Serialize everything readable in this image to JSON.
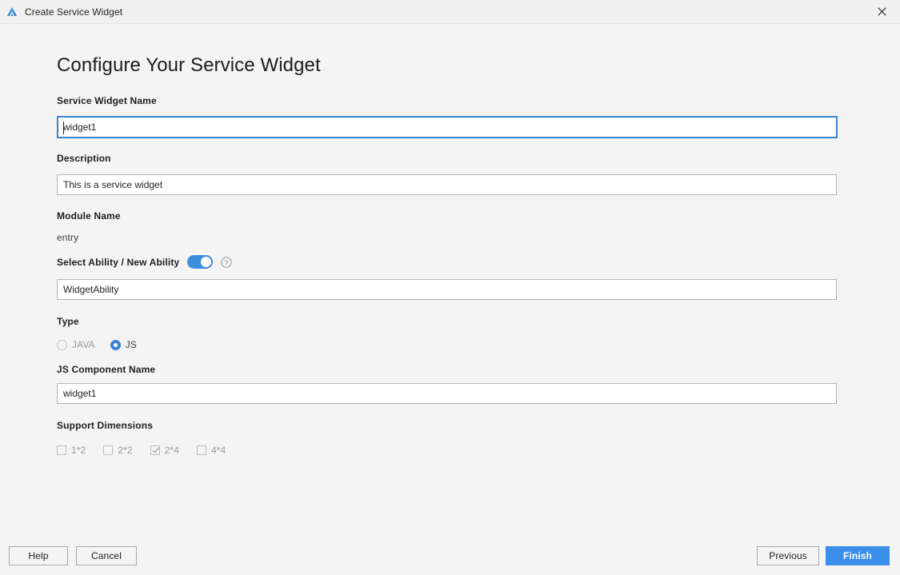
{
  "window": {
    "title": "Create Service Widget",
    "app_icon": "deveco-logo-icon",
    "close_icon": "close-icon"
  },
  "page": {
    "heading": "Configure Your Service Widget"
  },
  "form": {
    "service_widget_name": {
      "label": "Service Widget Name",
      "value": "widget1",
      "focused": true
    },
    "description": {
      "label": "Description",
      "value": "This is a service widget"
    },
    "module_name": {
      "label": "Module Name",
      "value": "entry"
    },
    "select_ability": {
      "label": "Select Ability / New Ability",
      "toggle_on": true,
      "help_icon": "question-circle-icon",
      "value": "WidgetAbility"
    },
    "type": {
      "label": "Type",
      "options": [
        {
          "label": "JAVA",
          "selected": false,
          "disabled": true
        },
        {
          "label": "JS",
          "selected": true,
          "disabled": false
        }
      ]
    },
    "js_component_name": {
      "label": "JS Component Name",
      "value": "widget1"
    },
    "support_dimensions": {
      "label": "Support Dimensions",
      "options": [
        {
          "label": "1*2",
          "checked": false,
          "disabled": true
        },
        {
          "label": "2*2",
          "checked": false,
          "disabled": true
        },
        {
          "label": "2*4",
          "checked": true,
          "disabled": true
        },
        {
          "label": "4*4",
          "checked": false,
          "disabled": true
        }
      ]
    }
  },
  "footer": {
    "help_label": "Help",
    "cancel_label": "Cancel",
    "previous_label": "Previous",
    "finish_label": "Finish"
  },
  "colors": {
    "accent": "#3b8fea",
    "focus_border": "#3c82d4",
    "toggle_on": "#3e8ede",
    "background": "#f4f4f4",
    "titlebar": "#f0f0f0"
  }
}
